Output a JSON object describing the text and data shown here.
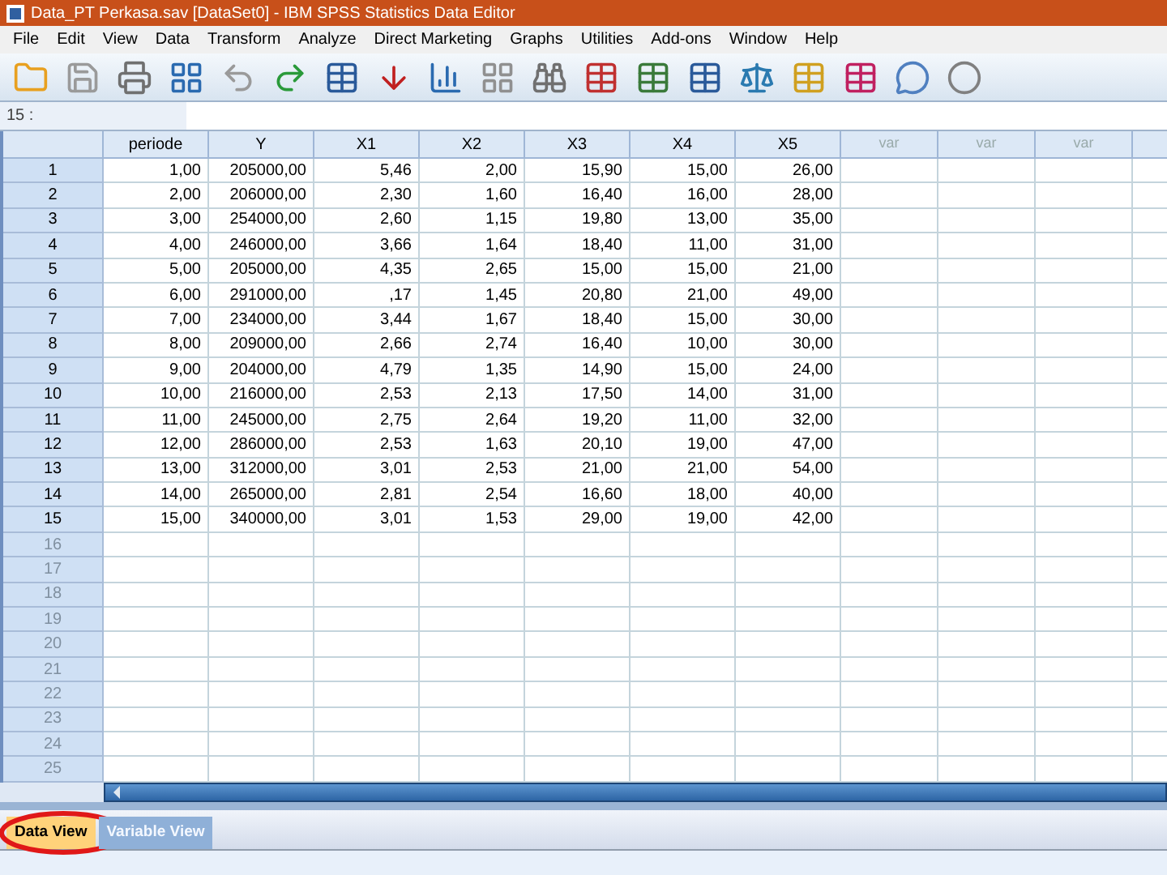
{
  "window": {
    "title": "Data_PT Perkasa.sav [DataSet0] - IBM SPSS Statistics Data Editor"
  },
  "menu": [
    "File",
    "Edit",
    "View",
    "Data",
    "Transform",
    "Analyze",
    "Direct Marketing",
    "Graphs",
    "Utilities",
    "Add-ons",
    "Window",
    "Help"
  ],
  "cell_reference": "15 :",
  "table": {
    "columns": [
      {
        "label": "periode",
        "kind": "var"
      },
      {
        "label": "Y",
        "kind": "var"
      },
      {
        "label": "X1",
        "kind": "var"
      },
      {
        "label": "X2",
        "kind": "var"
      },
      {
        "label": "X3",
        "kind": "var"
      },
      {
        "label": "X4",
        "kind": "var"
      },
      {
        "label": "X5",
        "kind": "var"
      },
      {
        "label": "var",
        "kind": "empty"
      },
      {
        "label": "var",
        "kind": "empty"
      },
      {
        "label": "var",
        "kind": "empty"
      }
    ],
    "rows": [
      {
        "number": "1",
        "cells": [
          "1,00",
          "205000,00",
          "5,46",
          "2,00",
          "15,90",
          "15,00",
          "26,00"
        ]
      },
      {
        "number": "2",
        "cells": [
          "2,00",
          "206000,00",
          "2,30",
          "1,60",
          "16,40",
          "16,00",
          "28,00"
        ]
      },
      {
        "number": "3",
        "cells": [
          "3,00",
          "254000,00",
          "2,60",
          "1,15",
          "19,80",
          "13,00",
          "35,00"
        ]
      },
      {
        "number": "4",
        "cells": [
          "4,00",
          "246000,00",
          "3,66",
          "1,64",
          "18,40",
          "11,00",
          "31,00"
        ]
      },
      {
        "number": "5",
        "cells": [
          "5,00",
          "205000,00",
          "4,35",
          "2,65",
          "15,00",
          "15,00",
          "21,00"
        ]
      },
      {
        "number": "6",
        "cells": [
          "6,00",
          "291000,00",
          ",17",
          "1,45",
          "20,80",
          "21,00",
          "49,00"
        ]
      },
      {
        "number": "7",
        "cells": [
          "7,00",
          "234000,00",
          "3,44",
          "1,67",
          "18,40",
          "15,00",
          "30,00"
        ]
      },
      {
        "number": "8",
        "cells": [
          "8,00",
          "209000,00",
          "2,66",
          "2,74",
          "16,40",
          "10,00",
          "30,00"
        ]
      },
      {
        "number": "9",
        "cells": [
          "9,00",
          "204000,00",
          "4,79",
          "1,35",
          "14,90",
          "15,00",
          "24,00"
        ]
      },
      {
        "number": "10",
        "cells": [
          "10,00",
          "216000,00",
          "2,53",
          "2,13",
          "17,50",
          "14,00",
          "31,00"
        ]
      },
      {
        "number": "11",
        "cells": [
          "11,00",
          "245000,00",
          "2,75",
          "2,64",
          "19,20",
          "11,00",
          "32,00"
        ]
      },
      {
        "number": "12",
        "cells": [
          "12,00",
          "286000,00",
          "2,53",
          "1,63",
          "20,10",
          "19,00",
          "47,00"
        ]
      },
      {
        "number": "13",
        "cells": [
          "13,00",
          "312000,00",
          "3,01",
          "2,53",
          "21,00",
          "21,00",
          "54,00"
        ]
      },
      {
        "number": "14",
        "cells": [
          "14,00",
          "265000,00",
          "2,81",
          "2,54",
          "16,60",
          "18,00",
          "40,00"
        ]
      },
      {
        "number": "15",
        "cells": [
          "15,00",
          "340000,00",
          "3,01",
          "1,53",
          "29,00",
          "19,00",
          "42,00"
        ]
      },
      {
        "number": "16",
        "cells": []
      },
      {
        "number": "17",
        "cells": []
      },
      {
        "number": "18",
        "cells": []
      },
      {
        "number": "19",
        "cells": []
      },
      {
        "number": "20",
        "cells": []
      },
      {
        "number": "21",
        "cells": []
      },
      {
        "number": "22",
        "cells": []
      },
      {
        "number": "23",
        "cells": []
      },
      {
        "number": "24",
        "cells": []
      },
      {
        "number": "25",
        "cells": []
      }
    ]
  },
  "tabs": [
    {
      "label": "Data View",
      "selected": true,
      "circled": true
    },
    {
      "label": "Variable View",
      "selected": false,
      "circled": false
    }
  ]
}
